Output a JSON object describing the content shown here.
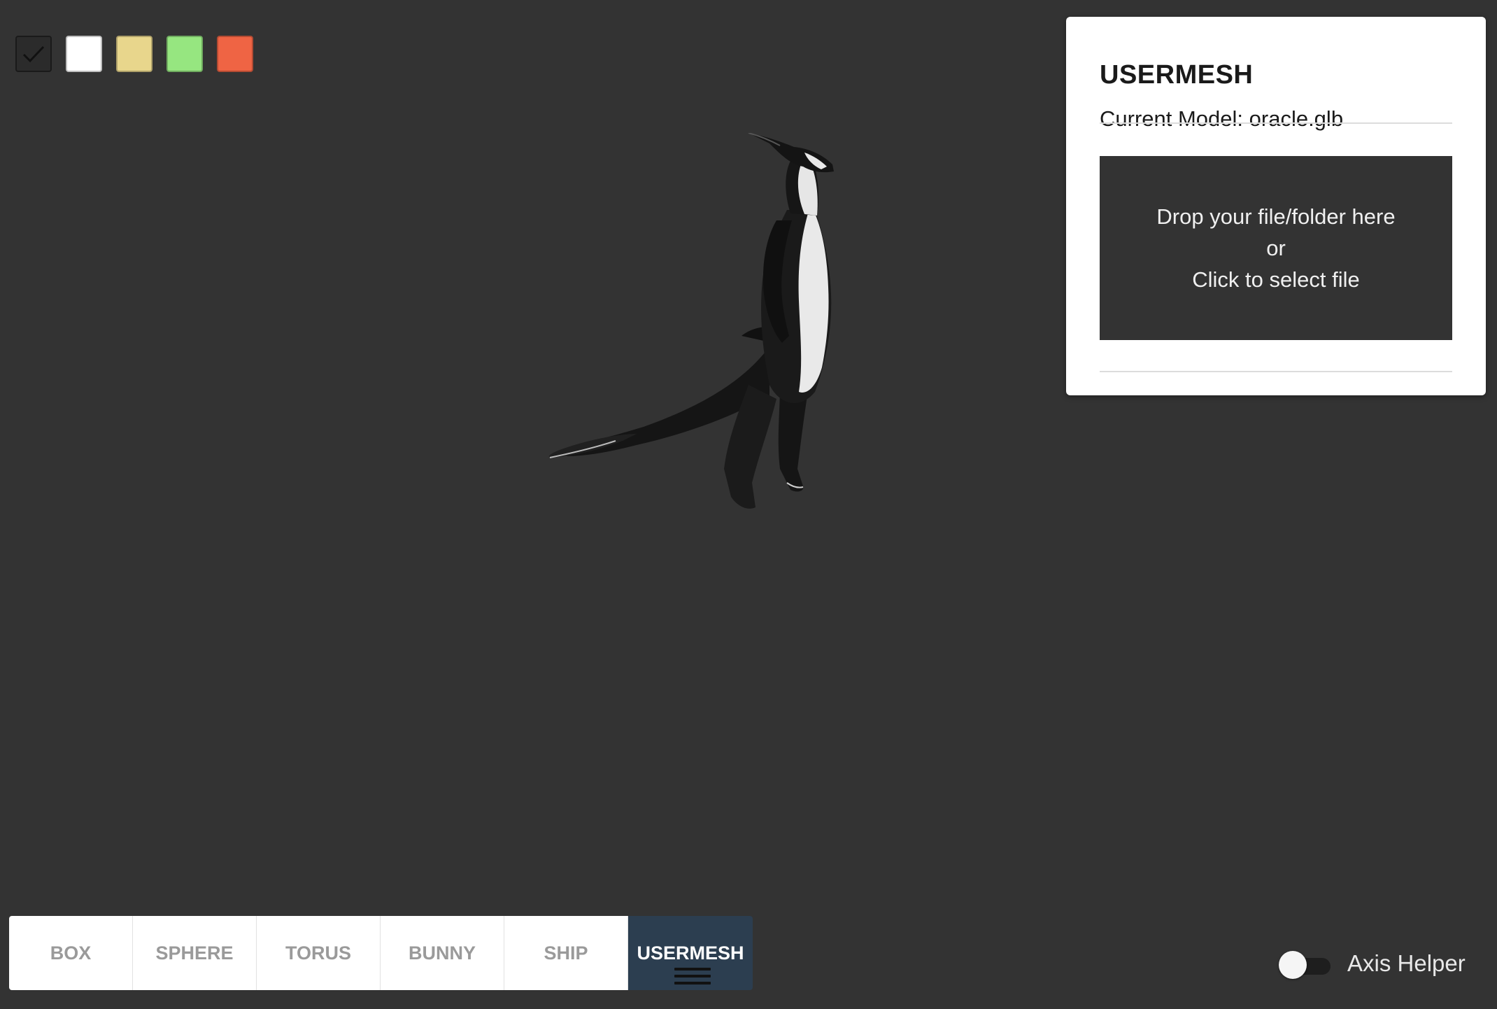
{
  "swatches": [
    {
      "name": "checked",
      "color": "#2b2b2b",
      "checked": true
    },
    {
      "name": "white",
      "color": "#ffffff"
    },
    {
      "name": "yellow",
      "color": "#e8d68c"
    },
    {
      "name": "green",
      "color": "#96e680"
    },
    {
      "name": "orange",
      "color": "#ef6444"
    }
  ],
  "panel": {
    "title": "USERMESH",
    "current_model": "Current Model: oracle.glb",
    "dropzone": {
      "line1": "Drop your file/folder here",
      "line2": "or",
      "line3": "Click to select file"
    }
  },
  "tabs": [
    {
      "label": "BOX"
    },
    {
      "label": "SPHERE"
    },
    {
      "label": "TORUS"
    },
    {
      "label": "BUNNY"
    },
    {
      "label": "SHIP"
    },
    {
      "label": "USERMESH",
      "active": true
    }
  ],
  "axis_helper": {
    "label": "Axis Helper",
    "enabled": false
  }
}
